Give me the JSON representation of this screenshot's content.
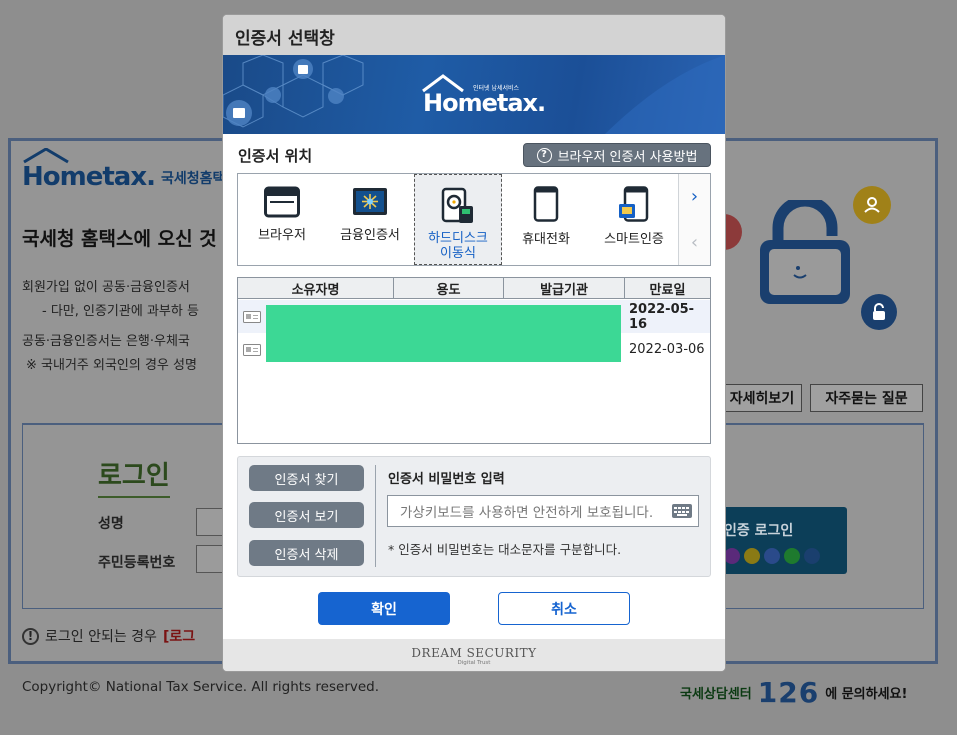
{
  "background": {
    "logo_word": "Hometax.",
    "logo_sub": "인터넷 납세서비스",
    "logo_kr": "국세청홈택스",
    "welcome": "국세청 홈택스에 오신 것",
    "lines": [
      "회원가입 없이 공동·금융인증서",
      "- 다만, 인증기관에 과부하 등",
      "공동·금융인증서는 은행·우체국",
      "※ 국내거주 외국인의 경우 성명"
    ],
    "detail_button": "자세히보기",
    "faq_button": "자주묻는 질문",
    "login_title": "로그인",
    "name_label": "성명",
    "rrn_label": "주민등록번호",
    "cert_login": "인증 로그인",
    "warn_text": "로그인 안되는 경우",
    "warn_red": "[로그",
    "copyright": "Copyright© National Tax Service. All rights reserved.",
    "center_a": "국세상담센터",
    "center_num": "126",
    "center_b": "에 문의하세요!"
  },
  "dialog": {
    "title": "인증서 선택창",
    "banner_word": "Hometax.",
    "banner_sub": "인터넷 납세서비스",
    "location_label": "인증서 위치",
    "help_button": "브라우저 인증서 사용방법",
    "locations": [
      {
        "label": "브라우저",
        "icon": "browser-icon"
      },
      {
        "label": "금융인증서",
        "icon": "financial-cert-icon"
      },
      {
        "label": "하드디스크\n이동식",
        "icon": "harddisk-icon",
        "selected": true
      },
      {
        "label": "휴대전화",
        "icon": "mobile-phone-icon"
      },
      {
        "label": "스마트인증",
        "icon": "smart-cert-icon"
      }
    ],
    "table": {
      "headers": [
        "소유자명",
        "용도",
        "발급기관",
        "만료일"
      ],
      "rows": [
        {
          "expiry": "2022-05-16",
          "bold": true
        },
        {
          "expiry": "2022-03-06",
          "bold": false
        }
      ]
    },
    "find_button": "인증서 찾기",
    "view_button": "인증서 보기",
    "delete_button": "인증서 삭제",
    "password_title": "인증서 비밀번호 입력",
    "password_placeholder": "가상키보드를 사용하면 안전하게 보호됩니다.",
    "password_note": "* 인증서 비밀번호는 대소문자를 구분합니다.",
    "ok_button": "확인",
    "cancel_button": "취소",
    "footer_brand": "DREAM SECURITY",
    "footer_sub": "Digital Trust"
  },
  "colors": {
    "primary_blue": "#1664d0",
    "redaction": "#3cd895",
    "overlay_gray": "#8e8e8e"
  }
}
